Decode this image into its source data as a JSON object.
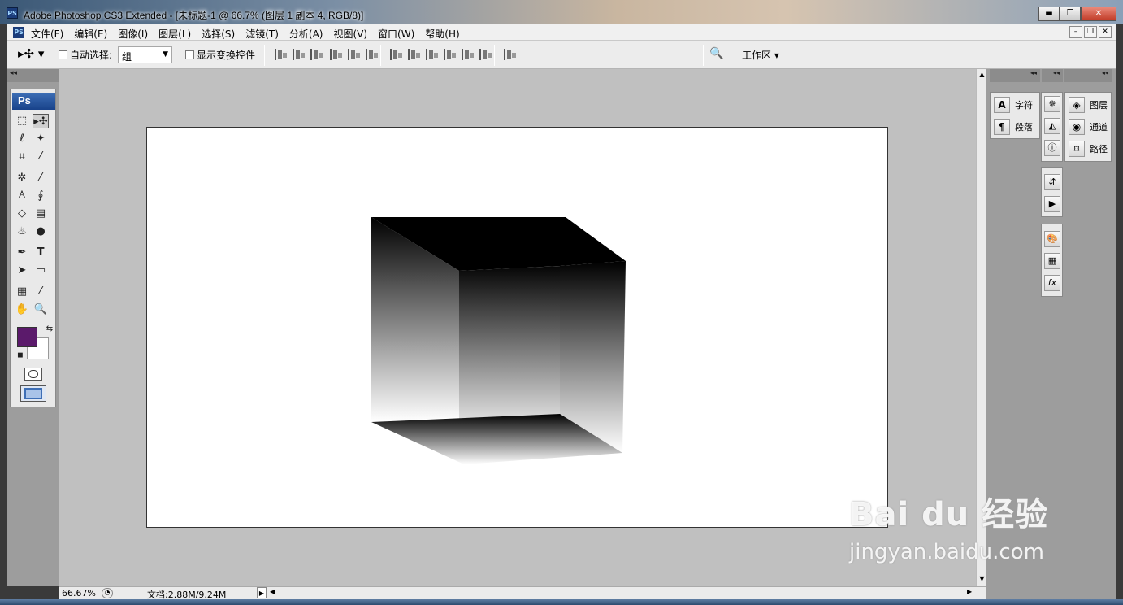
{
  "window": {
    "app_icon": "PS",
    "title": "Adobe Photoshop CS3 Extended - [未标题-1 @ 66.7% (图层 1 副本 4, RGB/8)]",
    "min_label": "▬",
    "restore_label": "❐",
    "close_label": "✕"
  },
  "menubar": {
    "items": [
      "文件(F)",
      "编辑(E)",
      "图像(I)",
      "图层(L)",
      "选择(S)",
      "滤镜(T)",
      "分析(A)",
      "视图(V)",
      "窗口(W)",
      "帮助(H)"
    ]
  },
  "options": {
    "auto_select_label": "自动选择:",
    "auto_select_value": "组",
    "show_transform_label": "显示变换控件",
    "workspace_label": "工作区 ▾"
  },
  "toolbox": {
    "badge": "Ps",
    "foreground_color": "#5b1a6b",
    "background_color": "#ffffff"
  },
  "statusbar": {
    "zoom": "66.67%",
    "doc_info": "文档:2.88M/9.24M"
  },
  "panels": {
    "character": "字符",
    "paragraph": "段落",
    "layers": "图层",
    "channels": "通道",
    "paths": "路径"
  },
  "watermark": {
    "brand": "Bai du 经验",
    "url": "jingyan.baidu.com"
  },
  "colors": {
    "canvas_bg": "#c0c0c0",
    "panel_bg": "#9d9d9d",
    "accent": "#18428a"
  }
}
